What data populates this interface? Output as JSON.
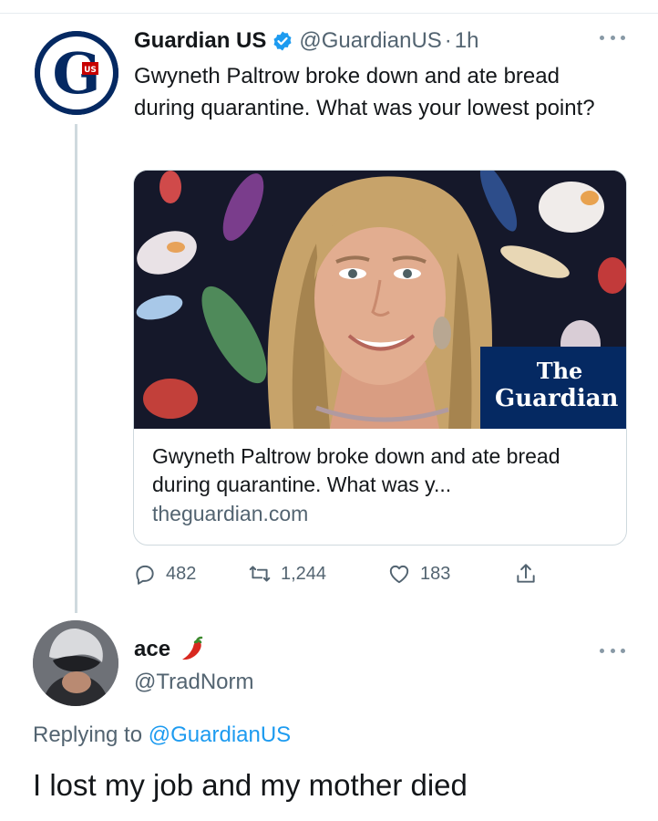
{
  "tweet": {
    "display_name": "Guardian US",
    "handle": "@GuardianUS",
    "separator": "·",
    "time": "1h",
    "text": "Gwyneth Paltrow broke down and ate bread during quarantine. What was your lowest point?",
    "avatar": {
      "letter": "G",
      "tag": "US",
      "color": "#052962"
    },
    "verified_icon": "verified-badge-icon",
    "more_icon": "more-horizontal-icon"
  },
  "card": {
    "image_alt": "Photo of Gwyneth Paltrow smiling against a dark patterned backdrop",
    "badge_line1": "The",
    "badge_line2": "Guardian",
    "title": "Gwyneth Paltrow broke down and ate bread during quarantine. What was y...",
    "domain": "theguardian.com"
  },
  "actions": {
    "reply_count": "482",
    "retweet_count": "1,244",
    "like_count": "183",
    "icons": [
      "reply-icon",
      "retweet-icon",
      "like-icon",
      "share-icon"
    ]
  },
  "reply": {
    "display_name": "ace",
    "name_emoji": "hot-pepper-icon",
    "handle": "@TradNorm",
    "replying_prefix": "Replying to",
    "replying_to": "@GuardianUS",
    "text": "I lost my job and my mother died"
  },
  "colors": {
    "text_primary": "#14171a",
    "text_secondary": "#536471",
    "link_blue": "#1d9bf0",
    "guardian_navy": "#052962",
    "border": "#cfd9de"
  }
}
